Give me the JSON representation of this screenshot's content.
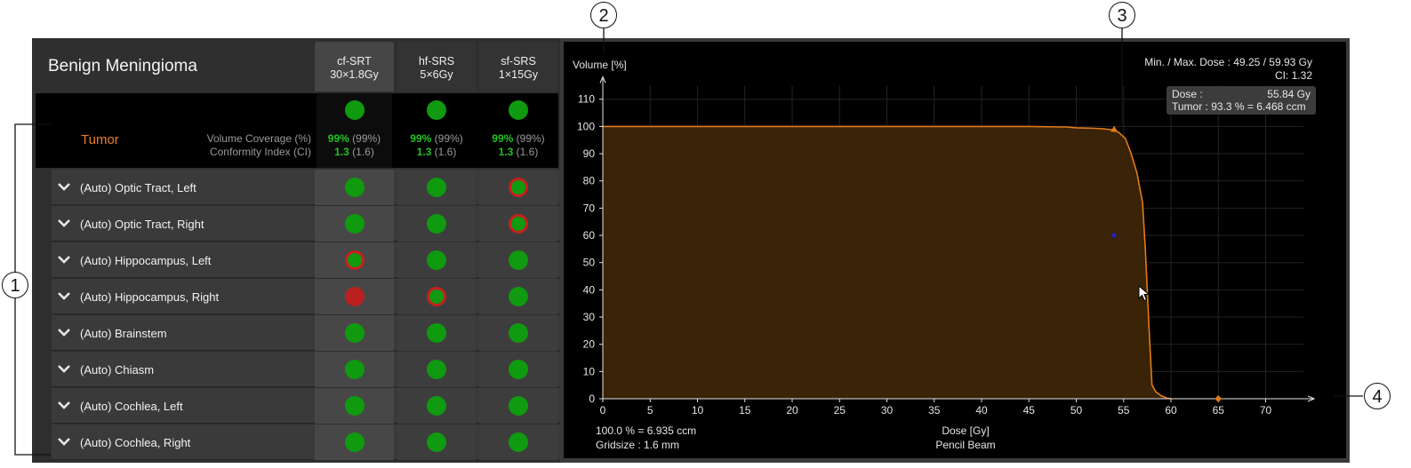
{
  "header": {
    "title": "Benign Meningioma"
  },
  "columns": [
    {
      "name": "cf-SRT",
      "sub": "30×1.8Gy",
      "selected": true
    },
    {
      "name": "hf-SRS",
      "sub": "5×6Gy",
      "selected": false
    },
    {
      "name": "sf-SRS",
      "sub": "1×15Gy",
      "selected": false
    }
  ],
  "tumor": {
    "name": "Tumor",
    "label_coverage": "Volume Coverage (%)",
    "label_ci": "Conformity Index (CI)",
    "cells": [
      {
        "coverage": "99%",
        "coverage_ref": "(99%)",
        "ci": "1.3",
        "ci_ref": "(1.6)",
        "status": "ok"
      },
      {
        "coverage": "99%",
        "coverage_ref": "(99%)",
        "ci": "1.3",
        "ci_ref": "(1.6)",
        "status": "ok"
      },
      {
        "coverage": "99%",
        "coverage_ref": "(99%)",
        "ci": "1.3",
        "ci_ref": "(1.6)",
        "status": "ok"
      }
    ]
  },
  "organs": [
    {
      "label": "(Auto) Optic Tract, Left",
      "status": [
        "ok",
        "ok",
        "warn"
      ]
    },
    {
      "label": "(Auto) Optic Tract, Right",
      "status": [
        "ok",
        "ok",
        "warn"
      ]
    },
    {
      "label": "(Auto) Hippocampus, Left",
      "status": [
        "warn",
        "ok",
        "ok"
      ]
    },
    {
      "label": "(Auto) Hippocampus, Right",
      "status": [
        "bad",
        "warn",
        "ok"
      ]
    },
    {
      "label": "(Auto) Brainstem",
      "status": [
        "ok",
        "ok",
        "ok"
      ]
    },
    {
      "label": "(Auto) Chiasm",
      "status": [
        "ok",
        "ok",
        "ok"
      ]
    },
    {
      "label": "(Auto) Cochlea, Left",
      "status": [
        "ok",
        "ok",
        "ok"
      ]
    },
    {
      "label": "(Auto) Cochlea, Right",
      "status": [
        "ok",
        "ok",
        "ok"
      ]
    }
  ],
  "callouts": [
    "1",
    "2",
    "3",
    "4"
  ],
  "info": {
    "minmax": "Min. / Max. Dose : 49.25 / 59.93 Gy",
    "ci": "CI: 1.32",
    "dose_label": "Dose   :",
    "dose_value": "55.84 Gy",
    "tumor_readout": "Tumor : 93.3 % = 6.468 ccm"
  },
  "footer": {
    "volume": "100.0 % = 6.935 ccm",
    "gridsize": "Gridsize : 1.6 mm",
    "algorithm": "Pencil Beam"
  },
  "chart_data": {
    "type": "line",
    "title": "",
    "xlabel": "Dose [Gy]",
    "ylabel": "Volume [%]",
    "xlim": [
      0,
      74
    ],
    "ylim": [
      0,
      115
    ],
    "xticks": [
      0,
      5,
      10,
      15,
      20,
      25,
      30,
      35,
      40,
      45,
      50,
      55,
      60,
      65,
      70
    ],
    "yticks": [
      0,
      10,
      20,
      30,
      40,
      50,
      60,
      70,
      80,
      90,
      100,
      110
    ],
    "grid": true,
    "series": [
      {
        "color": "#e07b1a",
        "fill": "#3a2306",
        "x": [
          0,
          45,
          49,
          50,
          51,
          52,
          53,
          53.8,
          54.5,
          55.2,
          55.8,
          56.4,
          57,
          57.3,
          57.7,
          58,
          58.4,
          59,
          59.6,
          60
        ],
        "y": [
          100,
          100,
          99.8,
          99.5,
          99.4,
          99.3,
          99.1,
          98.8,
          97.8,
          95.5,
          90,
          83,
          72,
          55,
          25,
          5,
          2.5,
          1,
          0.2,
          0
        ]
      }
    ],
    "markers": [
      {
        "x": 54,
        "y": 99,
        "color": "#e07b1a"
      },
      {
        "x": 54,
        "y": 60,
        "color": "#2222cc"
      },
      {
        "x": 65,
        "y": 0,
        "color": "#e07b1a"
      }
    ]
  },
  "colors": {
    "ok": "#0f9a0f",
    "warn_ring": "#c42020",
    "bad": "#b82020",
    "accent": "#ee7d22"
  }
}
